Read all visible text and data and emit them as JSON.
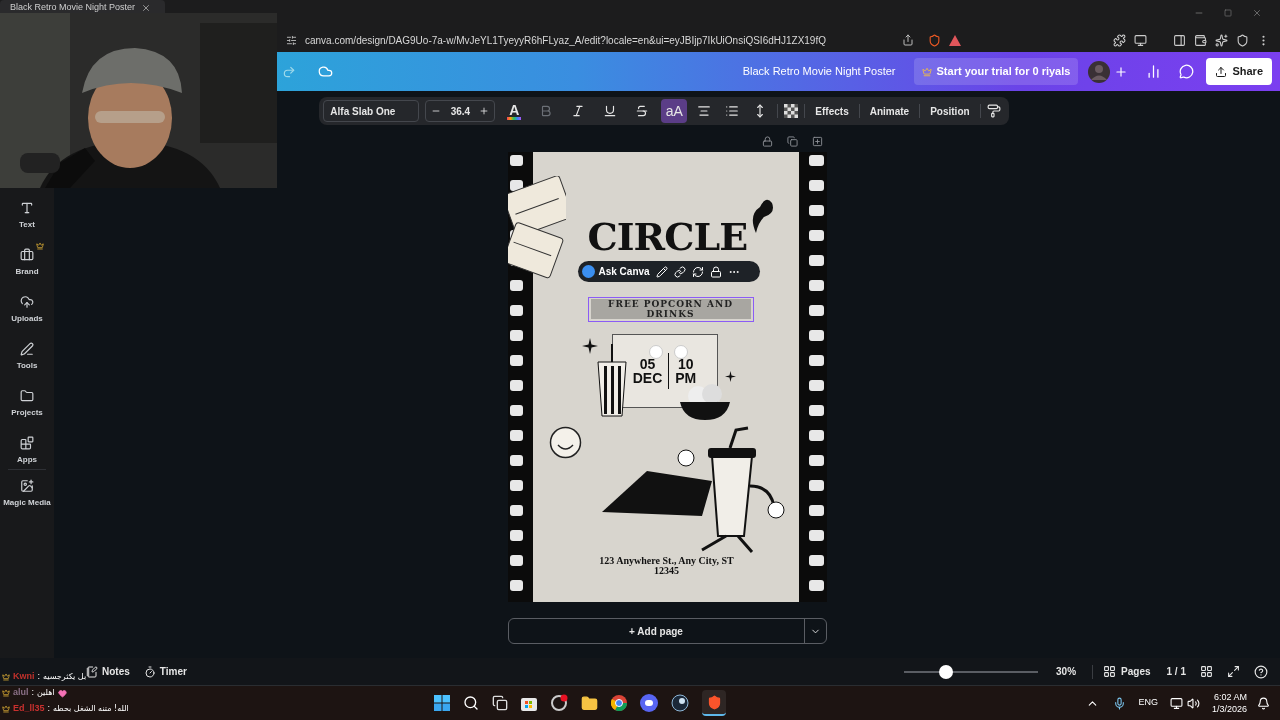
{
  "browser": {
    "tab_title": "Black Retro Movie Night Poster",
    "url": "canva.com/design/DAG9Uo-7a-w/MvJeYL1TyeyyR6hFLyaz_A/edit?locale=en&ui=eyJBIjp7IkUiOnsiQSI6dHJ1ZX19fQ"
  },
  "header": {
    "title": "Black Retro Movie Night Poster",
    "trial_button": "Start your trial for 0 riyals",
    "share_button": "Share"
  },
  "sidebar": {
    "items": [
      {
        "label": "Text",
        "kind": "text",
        "premium": false
      },
      {
        "label": "Brand",
        "kind": "brand",
        "premium": true
      },
      {
        "label": "Uploads",
        "kind": "uploads",
        "premium": false
      },
      {
        "label": "Tools",
        "kind": "tools",
        "premium": false
      },
      {
        "label": "Projects",
        "kind": "projects",
        "premium": false
      },
      {
        "label": "Apps",
        "kind": "apps",
        "premium": false
      },
      {
        "label": "Magic Media",
        "kind": "magic",
        "premium": false
      }
    ]
  },
  "toolbar": {
    "font": "Alfa Slab One",
    "size": "36.4",
    "format_buttons": [
      {
        "label": "A",
        "kind": "color",
        "selected": false,
        "disabled": false
      },
      {
        "kind": "bold",
        "selected": false,
        "disabled": true
      },
      {
        "kind": "italic",
        "selected": false,
        "disabled": false
      },
      {
        "kind": "underline",
        "selected": false,
        "disabled": false
      },
      {
        "kind": "strike",
        "selected": false,
        "disabled": false
      },
      {
        "label": "aA",
        "kind": "case",
        "selected": true,
        "disabled": false
      }
    ],
    "menu_buttons": [
      "Effects",
      "Animate",
      "Position"
    ]
  },
  "poster": {
    "title": "CIRCLE",
    "selected_text": "FREE POPCORN AND DRINKS",
    "date_day": "05",
    "date_month": "DEC",
    "time_hour": "10",
    "time_period": "PM",
    "address": "123 Anywhere St., Any City, ST 12345"
  },
  "context_bar": {
    "label": "Ask Canva"
  },
  "add_page": "+ Add page",
  "footer": {
    "notes": "Notes",
    "timer": "Timer",
    "zoom": {
      "level": 0.31,
      "reading": "30%"
    },
    "pages": "Pages",
    "page_count": "1 / 1"
  },
  "chat": [
    {
      "user": "Kwni",
      "separator": ":",
      "message": "بل يكثرجسيه",
      "color": "#c0312b"
    },
    {
      "user": "alul",
      "separator": ":",
      "message": "اهلين",
      "color": "#8a6f86"
    },
    {
      "user": "Ed_ll35",
      "separator": ":",
      "message": "الله! متنه الشغل بحطه",
      "color": "#c8302e"
    }
  ],
  "taskbar": {
    "language": "ENG",
    "time": "6:02 AM",
    "date": "1/3/2026"
  }
}
